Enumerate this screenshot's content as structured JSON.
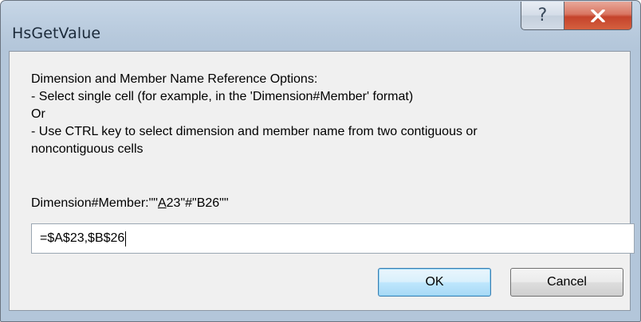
{
  "window": {
    "title": "HsGetValue"
  },
  "caption_buttons": {
    "help": "?",
    "close": "X"
  },
  "description": {
    "lines": [
      "Dimension and Member Name Reference Options:",
      "- Select single cell (for example, in the 'Dimension#Member' format)",
      "Or",
      "- Use CTRL key to select dimension and member name from two contiguous or",
      "noncontiguous cells"
    ]
  },
  "field": {
    "label_prefix": "Dimension#Member:\"\"",
    "label_mnemonic": "A",
    "label_suffix": "23\"#\"B26\"\"",
    "value": "=$A$23,$B$26"
  },
  "buttons": {
    "ok": "OK",
    "cancel": "Cancel"
  },
  "colors": {
    "close_button": "#c5432b",
    "default_button_border": "#3c7fb1"
  }
}
